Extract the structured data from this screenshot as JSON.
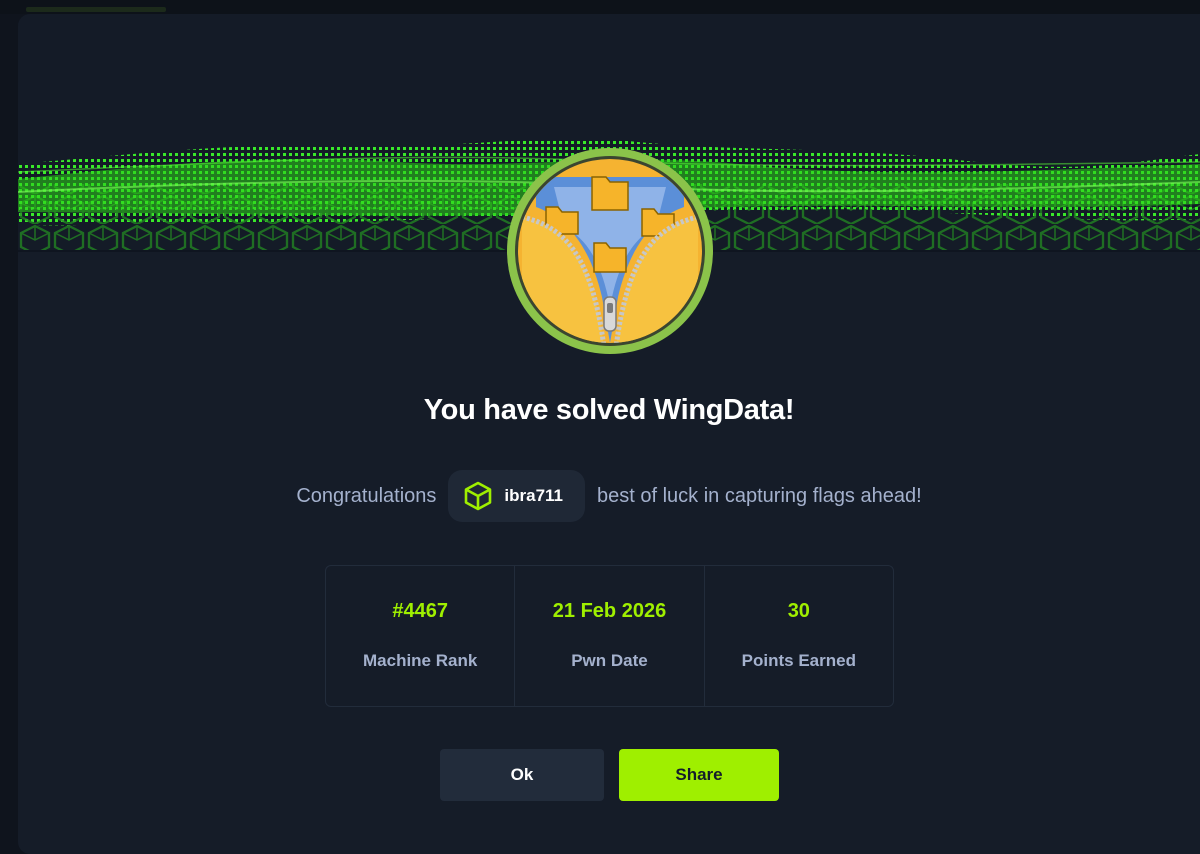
{
  "modal": {
    "title": "You have solved WingData!",
    "congrats_prefix": "Congratulations",
    "congrats_suffix": "best of luck in capturing flags ahead!",
    "username": "ibra711",
    "stats": [
      {
        "value": "#4467",
        "label": "Machine Rank"
      },
      {
        "value": "21 Feb 2026",
        "label": "Pwn Date"
      },
      {
        "value": "30",
        "label": "Points Earned"
      }
    ],
    "buttons": {
      "ok_label": "Ok",
      "share_label": "Share"
    }
  },
  "icons": {
    "avatar": "wingdata-zipper-folders-icon",
    "user": "green-cube-icon"
  },
  "colors": {
    "accent": "#9fef00",
    "background": "#151c28",
    "muted_text": "#a4b1cd",
    "avatar_ring": "#8bc34a"
  }
}
